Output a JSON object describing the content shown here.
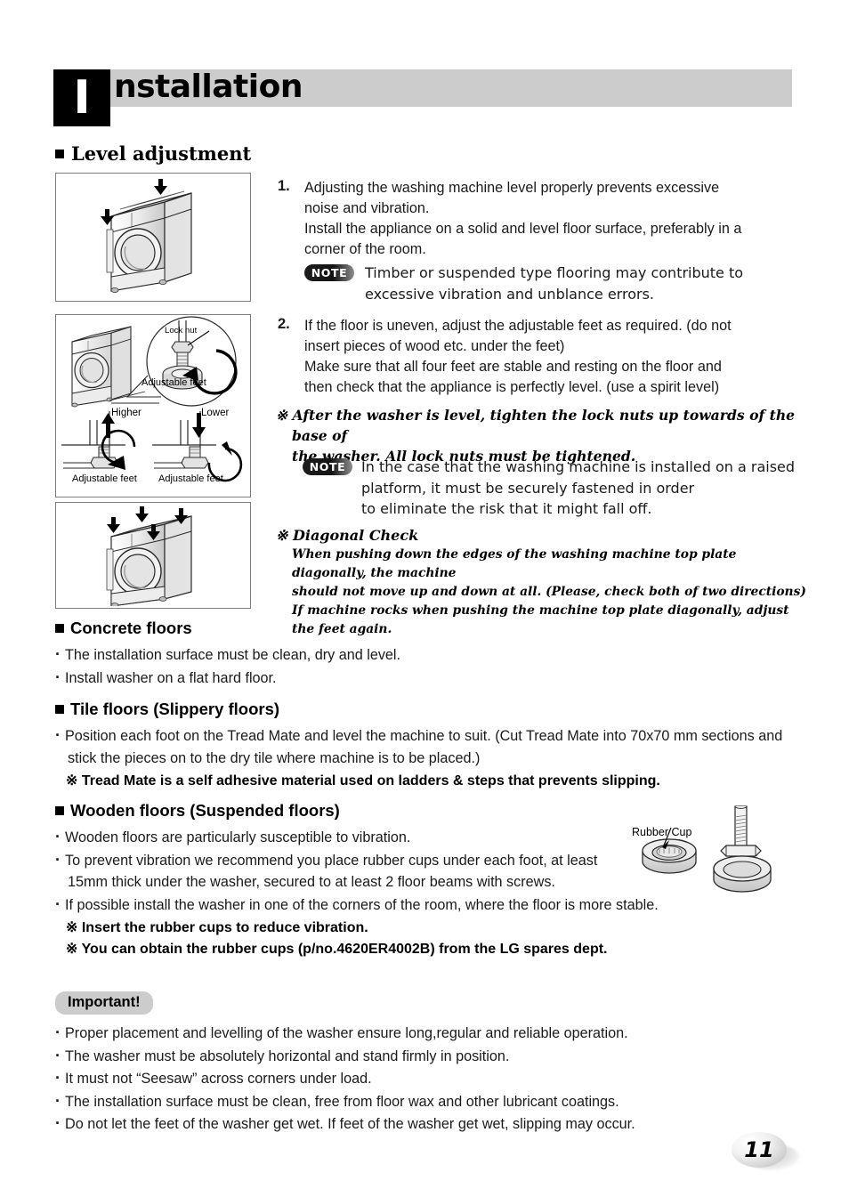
{
  "header": {
    "drop_cap": "I",
    "title": "nstallation"
  },
  "section_title": "Level adjustment",
  "steps": [
    {
      "num": "1.",
      "lines": [
        "Adjusting the washing machine level properly prevents excessive",
        "noise and vibration.",
        "Install the appliance on a solid and level floor surface, preferably in a",
        "corner of the room."
      ],
      "note": {
        "badge": "NOTE",
        "lines": [
          "Timber or suspended type flooring may contribute to",
          "excessive vibration and unblance errors."
        ]
      }
    },
    {
      "num": "2.",
      "lines": [
        "If the floor is uneven, adjust the adjustable feet as required. (do not",
        "insert pieces of wood etc. under the feet)",
        "Make sure that all four feet are stable and resting on the floor and",
        "then check that the appliance is perfectly level. (use a spirit level)"
      ]
    }
  ],
  "after_level_note": {
    "marker": "※",
    "lines": [
      "After the washer is level, tighten the lock nuts up towards of the base of",
      "the washer. All lock nuts must be tightened."
    ]
  },
  "raised_platform_note": {
    "badge": "NOTE",
    "lines": [
      "In the case that the washing machine is installed on a raised",
      "platform, it must be securely fastened in order",
      "to eliminate the risk that it might fall off."
    ]
  },
  "diagonal_check": {
    "marker": "※",
    "heading": "Diagonal Check",
    "lines": [
      "When pushing down the edges of the washing machine top plate diagonally, the machine",
      "should not move up and down at all. (Please, check both of two directions)",
      "If machine rocks when pushing the machine top plate diagonally, adjust the feet again."
    ]
  },
  "illustrations": {
    "panel2_labels": {
      "lock_nut": "Lock nut",
      "adjustable_feet": "Adjustable feet",
      "higher": "Higher",
      "lower": "Lower",
      "adjustable_feet_left": "Adjustable feet",
      "adjustable_feet_right": "Adjustable feet"
    },
    "rubber_cup_label": "Rubber Cup"
  },
  "floors": [
    {
      "heading": "Concrete floors",
      "bullets": [
        "The installation surface must be clean, dry and level.",
        "Install washer on a flat hard floor."
      ],
      "notes": []
    },
    {
      "heading": "Tile floors (Slippery floors)",
      "bullets": [
        "Position each foot on the Tread Mate and level the machine to suit. (Cut Tread Mate into 70x70 mm sections and stick the pieces on to the dry tile where machine is to be placed.)"
      ],
      "notes": [
        "※ Tread Mate is a self adhesive material used on ladders & steps that prevents slipping."
      ]
    },
    {
      "heading": "Wooden floors (Suspended floors)",
      "bullets": [
        "Wooden floors are particularly susceptible to vibration.",
        "To prevent vibration we recommend you place rubber cups under each foot, at least 15mm thick under the washer, secured to at least 2 floor beams with screws.",
        "If possible install the washer in one of the corners of the room, where the floor is more stable."
      ],
      "notes": [
        "※ Insert the rubber cups to reduce vibration.",
        "※ You can obtain the rubber cups (p/no.4620ER4002B)  from the LG spares dept."
      ]
    }
  ],
  "important": {
    "badge": "Important!",
    "bullets": [
      "Proper placement and levelling of the washer ensure long,regular and reliable operation.",
      "The washer must be absolutely horizontal and stand firmly in position.",
      "It must not “Seesaw” across corners under load.",
      "The installation surface must be clean, free from floor wax and other lubricant coatings.",
      "Do not let the feet of the washer get wet. If feet of the washer get wet, slipping may occur."
    ]
  },
  "page_number": "11",
  "colors": {
    "header_band": "#cccccc",
    "badge_gray": "#cccccc",
    "panel_border": "#808080"
  }
}
